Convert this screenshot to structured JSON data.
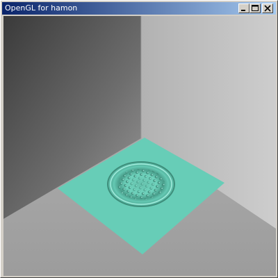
{
  "window": {
    "title": "OpenGL for hamon",
    "buttons": {
      "minimize": "minimize-icon",
      "maximize": "maximize-icon",
      "close": "close-icon"
    }
  },
  "colors": {
    "titlebar_start": "#0a246a",
    "titlebar_end": "#a6caf0",
    "water": "#67cdb7",
    "left_wall_dark": "#3c3c3c",
    "left_wall_light": "#8a8a8a",
    "right_wall": "#c4c4c4",
    "floor": "#a2a2a2"
  }
}
